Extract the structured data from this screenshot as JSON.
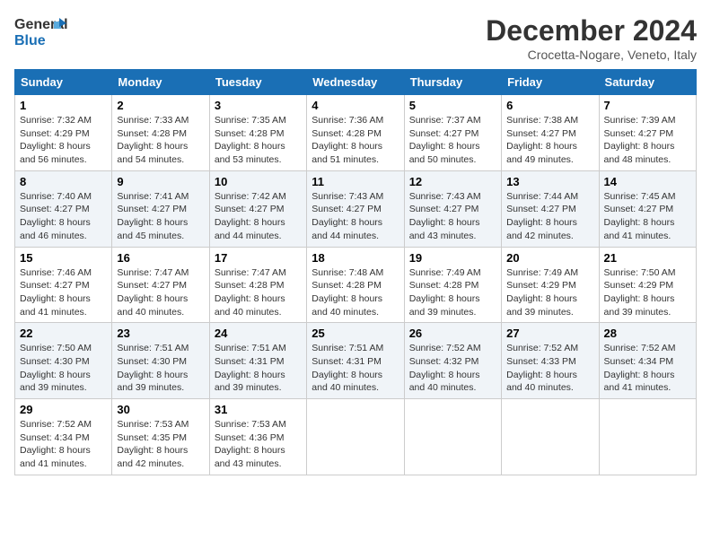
{
  "logo": {
    "line1": "General",
    "line2": "Blue"
  },
  "title": "December 2024",
  "location": "Crocetta-Nogare, Veneto, Italy",
  "days_of_week": [
    "Sunday",
    "Monday",
    "Tuesday",
    "Wednesday",
    "Thursday",
    "Friday",
    "Saturday"
  ],
  "weeks": [
    [
      {
        "day": "1",
        "sunrise": "7:32 AM",
        "sunset": "4:29 PM",
        "daylight": "8 hours and 56 minutes."
      },
      {
        "day": "2",
        "sunrise": "7:33 AM",
        "sunset": "4:28 PM",
        "daylight": "8 hours and 54 minutes."
      },
      {
        "day": "3",
        "sunrise": "7:35 AM",
        "sunset": "4:28 PM",
        "daylight": "8 hours and 53 minutes."
      },
      {
        "day": "4",
        "sunrise": "7:36 AM",
        "sunset": "4:28 PM",
        "daylight": "8 hours and 51 minutes."
      },
      {
        "day": "5",
        "sunrise": "7:37 AM",
        "sunset": "4:27 PM",
        "daylight": "8 hours and 50 minutes."
      },
      {
        "day": "6",
        "sunrise": "7:38 AM",
        "sunset": "4:27 PM",
        "daylight": "8 hours and 49 minutes."
      },
      {
        "day": "7",
        "sunrise": "7:39 AM",
        "sunset": "4:27 PM",
        "daylight": "8 hours and 48 minutes."
      }
    ],
    [
      {
        "day": "8",
        "sunrise": "7:40 AM",
        "sunset": "4:27 PM",
        "daylight": "8 hours and 46 minutes."
      },
      {
        "day": "9",
        "sunrise": "7:41 AM",
        "sunset": "4:27 PM",
        "daylight": "8 hours and 45 minutes."
      },
      {
        "day": "10",
        "sunrise": "7:42 AM",
        "sunset": "4:27 PM",
        "daylight": "8 hours and 44 minutes."
      },
      {
        "day": "11",
        "sunrise": "7:43 AM",
        "sunset": "4:27 PM",
        "daylight": "8 hours and 44 minutes."
      },
      {
        "day": "12",
        "sunrise": "7:43 AM",
        "sunset": "4:27 PM",
        "daylight": "8 hours and 43 minutes."
      },
      {
        "day": "13",
        "sunrise": "7:44 AM",
        "sunset": "4:27 PM",
        "daylight": "8 hours and 42 minutes."
      },
      {
        "day": "14",
        "sunrise": "7:45 AM",
        "sunset": "4:27 PM",
        "daylight": "8 hours and 41 minutes."
      }
    ],
    [
      {
        "day": "15",
        "sunrise": "7:46 AM",
        "sunset": "4:27 PM",
        "daylight": "8 hours and 41 minutes."
      },
      {
        "day": "16",
        "sunrise": "7:47 AM",
        "sunset": "4:27 PM",
        "daylight": "8 hours and 40 minutes."
      },
      {
        "day": "17",
        "sunrise": "7:47 AM",
        "sunset": "4:28 PM",
        "daylight": "8 hours and 40 minutes."
      },
      {
        "day": "18",
        "sunrise": "7:48 AM",
        "sunset": "4:28 PM",
        "daylight": "8 hours and 40 minutes."
      },
      {
        "day": "19",
        "sunrise": "7:49 AM",
        "sunset": "4:28 PM",
        "daylight": "8 hours and 39 minutes."
      },
      {
        "day": "20",
        "sunrise": "7:49 AM",
        "sunset": "4:29 PM",
        "daylight": "8 hours and 39 minutes."
      },
      {
        "day": "21",
        "sunrise": "7:50 AM",
        "sunset": "4:29 PM",
        "daylight": "8 hours and 39 minutes."
      }
    ],
    [
      {
        "day": "22",
        "sunrise": "7:50 AM",
        "sunset": "4:30 PM",
        "daylight": "8 hours and 39 minutes."
      },
      {
        "day": "23",
        "sunrise": "7:51 AM",
        "sunset": "4:30 PM",
        "daylight": "8 hours and 39 minutes."
      },
      {
        "day": "24",
        "sunrise": "7:51 AM",
        "sunset": "4:31 PM",
        "daylight": "8 hours and 39 minutes."
      },
      {
        "day": "25",
        "sunrise": "7:51 AM",
        "sunset": "4:31 PM",
        "daylight": "8 hours and 40 minutes."
      },
      {
        "day": "26",
        "sunrise": "7:52 AM",
        "sunset": "4:32 PM",
        "daylight": "8 hours and 40 minutes."
      },
      {
        "day": "27",
        "sunrise": "7:52 AM",
        "sunset": "4:33 PM",
        "daylight": "8 hours and 40 minutes."
      },
      {
        "day": "28",
        "sunrise": "7:52 AM",
        "sunset": "4:34 PM",
        "daylight": "8 hours and 41 minutes."
      }
    ],
    [
      {
        "day": "29",
        "sunrise": "7:52 AM",
        "sunset": "4:34 PM",
        "daylight": "8 hours and 41 minutes."
      },
      {
        "day": "30",
        "sunrise": "7:53 AM",
        "sunset": "4:35 PM",
        "daylight": "8 hours and 42 minutes."
      },
      {
        "day": "31",
        "sunrise": "7:53 AM",
        "sunset": "4:36 PM",
        "daylight": "8 hours and 43 minutes."
      },
      null,
      null,
      null,
      null
    ]
  ],
  "labels": {
    "sunrise": "Sunrise:",
    "sunset": "Sunset:",
    "daylight": "Daylight:"
  }
}
